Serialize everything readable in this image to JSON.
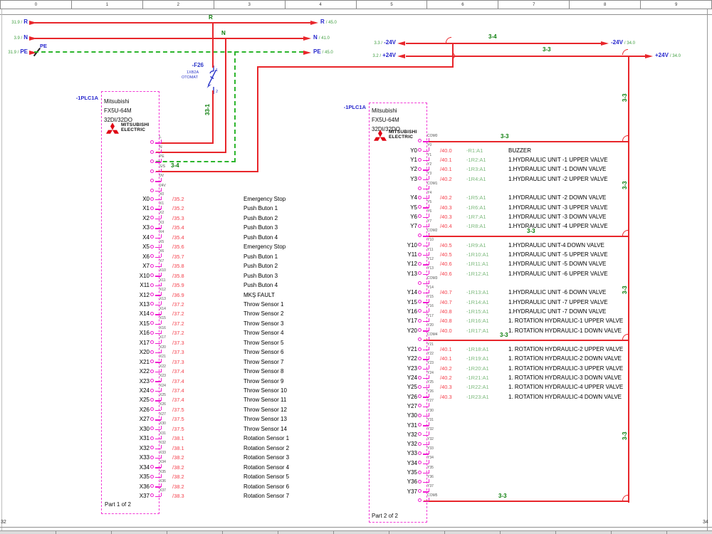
{
  "page": {
    "ruler": [
      "0",
      "1",
      "2",
      "3",
      "4",
      "5",
      "6",
      "7",
      "8",
      "9"
    ],
    "page_prev": "32",
    "page_next": "34"
  },
  "colors": {
    "wire_red": "#e8262b",
    "pe_green": "#2db52d",
    "net_green": "#0a7d0a",
    "device_green": "#7cb97c",
    "ref_red": "#f5424e",
    "label_blue": "#2727cd",
    "terminal_magenta": "#f01ad0",
    "logo_red": "#df0614"
  },
  "rails": {
    "r": {
      "left": "31.9 /",
      "sym": "R",
      "right": "/ 45.0"
    },
    "n": {
      "left": "3.9 /",
      "sym": "N",
      "right": "/ 41.0"
    },
    "pe": {
      "left": "31.9 /",
      "sym": "PE",
      "right": "/ 45.0",
      "tap": "PE"
    },
    "neg24": {
      "left": "3.3 /",
      "sym": "-24V",
      "right": "/ 34.0",
      "net": "3-4"
    },
    "pos24": {
      "left": "3.2 /",
      "sym": "+24V",
      "right": "/ 34.0",
      "net": "3-3"
    }
  },
  "nets": {
    "ss": "3-4",
    "r_drop": "33-1",
    "bus": "3-3"
  },
  "fuse": {
    "tag": "-F26",
    "type": "1XB2A",
    "note": "OTOMAT",
    "pin1": "1",
    "pin2": "2"
  },
  "plc_left": {
    "tag": "-1PLC1A",
    "model": [
      "Mitsubishi",
      "FX5U-64M",
      "32DI/32DO"
    ],
    "brand": [
      "MITSUBISHI",
      "ELECTRIC"
    ],
    "part": "Part 1 of 2",
    "terminals": [
      "L",
      "N",
      "PE",
      "S/S",
      "0V",
      "24V"
    ],
    "rows": [
      {
        "t": "X0",
        "r": "/35.2",
        "x": "Emergency Stop"
      },
      {
        "t": "X1",
        "r": "/35.2",
        "x": "Push Buton 1"
      },
      {
        "t": "X2",
        "r": "/35.3",
        "x": "Push Buton 2"
      },
      {
        "t": "X3",
        "r": "/35.4",
        "x": "Push Buton 3"
      },
      {
        "t": "X4",
        "r": "/35.4",
        "x": "Push Buton 4"
      },
      {
        "t": "X5",
        "r": "/35.6",
        "x": "Emergency Stop"
      },
      {
        "t": "X6",
        "r": "/35.7",
        "x": "Push Buton 1"
      },
      {
        "t": "X7",
        "r": "/35.8",
        "x": "Push Buton 2"
      },
      {
        "t": "X10",
        "r": "/35.8",
        "x": "Push Buton 3"
      },
      {
        "t": "X11",
        "r": "/35.9",
        "x": "Push Buton 4"
      },
      {
        "t": "X12",
        "r": "/36.9",
        "x": "MKŞ FAULT"
      },
      {
        "t": "X13",
        "r": "/37.2",
        "x": "Throw Sensor 1"
      },
      {
        "t": "X14",
        "r": "/37.2",
        "x": "Throw Sensor 2"
      },
      {
        "t": "X15",
        "r": "/37.2",
        "x": "Throw Sensor 3"
      },
      {
        "t": "X16",
        "r": "/37.2",
        "x": "Throw Sensor 4"
      },
      {
        "t": "X17",
        "r": "/37.3",
        "x": "Throw Sensor 5"
      },
      {
        "t": "X20",
        "r": "/37.3",
        "x": "Throw Sensor 6"
      },
      {
        "t": "X21",
        "r": "/37.3",
        "x": "Throw Sensor 7"
      },
      {
        "t": "X22",
        "r": "/37.4",
        "x": "Throw Sensor 8"
      },
      {
        "t": "X23",
        "r": "/37.4",
        "x": "Throw Sensor 9"
      },
      {
        "t": "X24",
        "r": "/37.4",
        "x": "Throw Sensor 10"
      },
      {
        "t": "X25",
        "r": "/37.4",
        "x": "Throw Sensor 11"
      },
      {
        "t": "X26",
        "r": "/37.5",
        "x": "Throw Sensor 12"
      },
      {
        "t": "X27",
        "r": "/37.5",
        "x": "Throw Sensor 13"
      },
      {
        "t": "X30",
        "r": "/37.5",
        "x": "Throw Sensor 14"
      },
      {
        "t": "X31",
        "r": "/38.1",
        "x": "Rotation Sensor 1"
      },
      {
        "t": "X32",
        "r": "/38.1",
        "x": "Rotation Sensor 2"
      },
      {
        "t": "X33",
        "r": "/38.2",
        "x": "Rotation Sensor 3"
      },
      {
        "t": "X34",
        "r": "/38.2",
        "x": "Rotation Sensor 4"
      },
      {
        "t": "X35",
        "r": "/38.2",
        "x": "Rotation Sensor 5"
      },
      {
        "t": "X36",
        "r": "/38.2",
        "x": "Rotation Sensor 6"
      },
      {
        "t": "X37",
        "r": "/38.3",
        "x": "Rotation Sensor 7"
      }
    ]
  },
  "plc_right": {
    "tag": "-1PLC1A",
    "model": [
      "Mitsubishi",
      "FX5U-64M",
      "32DI/32DO"
    ],
    "brand": [
      "MITSUBISHI",
      "ELECTRIC"
    ],
    "part": "Part 2 of 2",
    "rows": [
      {
        "t": "COM0",
        "com": true,
        "net": "3-3"
      },
      {
        "t": "Y0",
        "r": "/40.0",
        "d": "-R1:A1",
        "x": "BUZZER"
      },
      {
        "t": "Y1",
        "r": "/40.1",
        "d": "-1R2:A1",
        "x": "1.HYDRAULIC UNIT -1 UPPER VALVE"
      },
      {
        "t": "Y2",
        "r": "/40.1",
        "d": "-1R3:A1",
        "x": "1.HYDRAULIC UNIT -1 DOWN VALVE"
      },
      {
        "t": "Y3",
        "r": "/40.2",
        "d": "-1R4:A1",
        "x": "1.HYDRAULIC UNIT -2 UPPER VALVE"
      },
      {
        "t": "COM1",
        "com": true
      },
      {
        "t": "Y4",
        "r": "/40.2",
        "d": "-1R5:A1",
        "x": "1.HYDRAULIC UNIT -2 DOWN VALVE"
      },
      {
        "t": "Y5",
        "r": "/40.3",
        "d": "-1R6:A1",
        "x": "1.HYDRAULIC UNIT -3 UPPER VALVE"
      },
      {
        "t": "Y6",
        "r": "/40.3",
        "d": "-1R7:A1",
        "x": "1.HYDRAULIC UNIT -3 DOWN VALVE"
      },
      {
        "t": "Y7",
        "r": "/40.4",
        "d": "-1R8:A1",
        "x": "1.HYDRAULIC UNIT -4 UPPER VALVE"
      },
      {
        "t": "COM2",
        "com": true,
        "net": "3-3"
      },
      {
        "t": "Y10",
        "r": "/40.5",
        "d": "-1R9:A1",
        "x": "1.HYDRAULIC UNIT-4 DOWN VALVE"
      },
      {
        "t": "Y11",
        "r": "/40.5",
        "d": "-1R10:A1",
        "x": "1.HYDRAULIC UNIT -5 UPPER VALVE"
      },
      {
        "t": "Y12",
        "r": "/40.6",
        "d": "-1R11:A1",
        "x": "1.HYDRAULIC UNIT -5 DOWN VALVE"
      },
      {
        "t": "Y13",
        "r": "/40.6",
        "d": "-1R12:A1",
        "x": "1.HYDRAULIC UNIT -6 UPPER VALVE"
      },
      {
        "t": "COM3",
        "com": true
      },
      {
        "t": "Y14",
        "r": "/40.7",
        "d": "-1R13:A1",
        "x": "1.HYDRAULIC UNIT -6 DOWN VALVE"
      },
      {
        "t": "Y15",
        "r": "/40.7",
        "d": "-1R14:A1",
        "x": "1.HYDRAULIC UNIT -7 UPPER VALVE"
      },
      {
        "t": "Y16",
        "r": "/40.8",
        "d": "-1R15:A1",
        "x": "1.HYDRAULIC UNIT -7 DOWN VALVE"
      },
      {
        "t": "Y17",
        "r": "/40.8",
        "d": "-1R16:A1",
        "x": "1. ROTATİON HYDRAULIC-1 UPPER VALVE"
      },
      {
        "t": "Y20",
        "r": "/40.0",
        "d": "-1R17:A1",
        "x": "1. ROTATİON HYDRAULIC-1 DOWN VALVE"
      },
      {
        "t": "COM4",
        "com": true,
        "net": "3-3"
      },
      {
        "t": "Y21",
        "r": "/40.1",
        "d": "-1R18:A1",
        "x": "1. ROTATİON HYDRAULIC-2 UPPER VALVE"
      },
      {
        "t": "Y22",
        "r": "/40.1",
        "d": "-1R19:A1",
        "x": "1. ROTATİON HYDRAULIC-2 DOWN VALVE"
      },
      {
        "t": "Y23",
        "r": "/40.2",
        "d": "-1R20:A1",
        "x": "1. ROTATİON HYDRAULIC-3 UPPER VALVE"
      },
      {
        "t": "Y24",
        "r": "/40.2",
        "d": "-1R21:A1",
        "x": "1. ROTATİON HYDRAULIC-3 DOWN VALVE"
      },
      {
        "t": "Y25",
        "r": "/40.3",
        "d": "-1R22:A1",
        "x": "1. ROTATİON HYDRAULIC-4 UPPER VALVE"
      },
      {
        "t": "Y26",
        "r": "/40.3",
        "d": "-1R23:A1",
        "x": "1. ROTATİON HYDRAULIC-4 DOWN VALVE"
      },
      {
        "t": "Y27"
      },
      {
        "t": "Y30"
      },
      {
        "t": "Y31"
      },
      {
        "t": "Y32"
      },
      {
        "t": "Y32"
      },
      {
        "t": "Y33"
      },
      {
        "t": "Y34"
      },
      {
        "t": "Y35"
      },
      {
        "t": "Y36"
      },
      {
        "t": "Y37"
      },
      {
        "t": "COM5",
        "com": true,
        "net": "3-3"
      }
    ]
  }
}
